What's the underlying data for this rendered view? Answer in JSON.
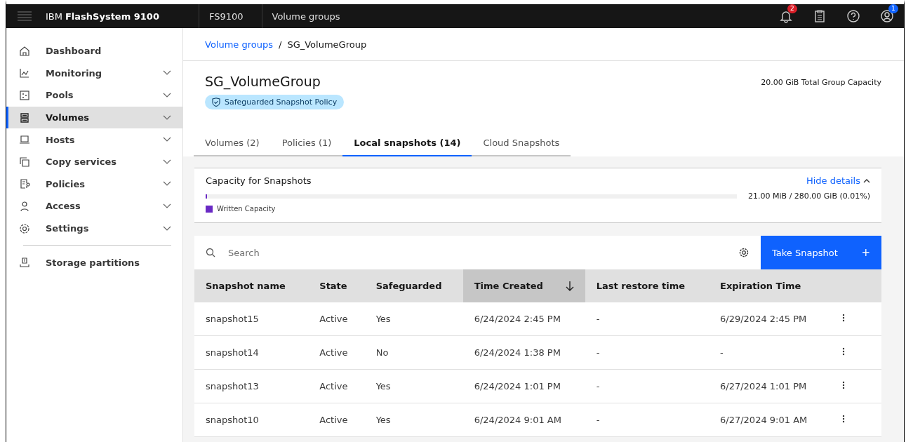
{
  "header": {
    "brand_prefix": "IBM",
    "brand_name": "FlashSystem 9100",
    "system": "FS9100",
    "page": "Volume groups",
    "notifications_badge": "2",
    "user_badge": "1"
  },
  "sidebar": {
    "items": [
      {
        "label": "Dashboard",
        "kind": "home",
        "expandable": false,
        "selected": false
      },
      {
        "label": "Monitoring",
        "kind": "chart",
        "expandable": true,
        "selected": false
      },
      {
        "label": "Pools",
        "kind": "pools",
        "expandable": true,
        "selected": false
      },
      {
        "label": "Volumes",
        "kind": "volumes",
        "expandable": true,
        "selected": true
      },
      {
        "label": "Hosts",
        "kind": "laptop",
        "expandable": true,
        "selected": false
      },
      {
        "label": "Copy services",
        "kind": "copy",
        "expandable": true,
        "selected": false
      },
      {
        "label": "Policies",
        "kind": "policy",
        "expandable": true,
        "selected": false
      },
      {
        "label": "Access",
        "kind": "user",
        "expandable": true,
        "selected": false
      },
      {
        "label": "Settings",
        "kind": "gear",
        "expandable": true,
        "selected": false
      }
    ],
    "bottom_items": [
      {
        "label": "Storage partitions",
        "kind": "partition",
        "expandable": false,
        "selected": false
      }
    ]
  },
  "breadcrumb": {
    "link": "Volume groups",
    "separator": "/",
    "current": "SG_VolumeGroup"
  },
  "group": {
    "title": "SG_VolumeGroup",
    "tag": "Safeguarded Snapshot Policy",
    "capacity": "20.00 GiB Total Group Capacity"
  },
  "tabs": [
    {
      "label": "Volumes (2)",
      "selected": false
    },
    {
      "label": "Policies (1)",
      "selected": false
    },
    {
      "label": "Local snapshots (14)",
      "selected": true
    },
    {
      "label": "Cloud Snapshots",
      "selected": false
    }
  ],
  "capacity_card": {
    "title": "Capacity for Snapshots",
    "toggle": "Hide details",
    "expanded": true,
    "level": 0.0001,
    "reading": "21.00 MiB / 280.00 GiB (0.01%)",
    "legend": "Written Capacity",
    "color": "#6929c4"
  },
  "toolbar": {
    "search_placeholder": "Search",
    "primary_button": "Take Snapshot",
    "primary_icon": "+"
  },
  "table": {
    "columns": [
      {
        "label": "Snapshot name",
        "sorted": false
      },
      {
        "label": "State",
        "sorted": false
      },
      {
        "label": "Safeguarded",
        "sorted": false
      },
      {
        "label": "Time Created",
        "sorted": true
      },
      {
        "label": "Last restore time",
        "sorted": false
      },
      {
        "label": "Expiration Time",
        "sorted": false
      }
    ],
    "rows": [
      [
        "snapshot15",
        "Active",
        "Yes",
        "6/24/2024 2:45 PM",
        "-",
        "6/29/2024 2:45 PM"
      ],
      [
        "snapshot14",
        "Active",
        "No",
        "6/24/2024 1:38 PM",
        "-",
        "-"
      ],
      [
        "snapshot13",
        "Active",
        "Yes",
        "6/24/2024 1:01 PM",
        "-",
        "6/27/2024 1:01 PM"
      ],
      [
        "snapshot10",
        "Active",
        "Yes",
        "6/24/2024 9:01 AM",
        "-",
        "6/27/2024 9:01 AM"
      ]
    ]
  }
}
